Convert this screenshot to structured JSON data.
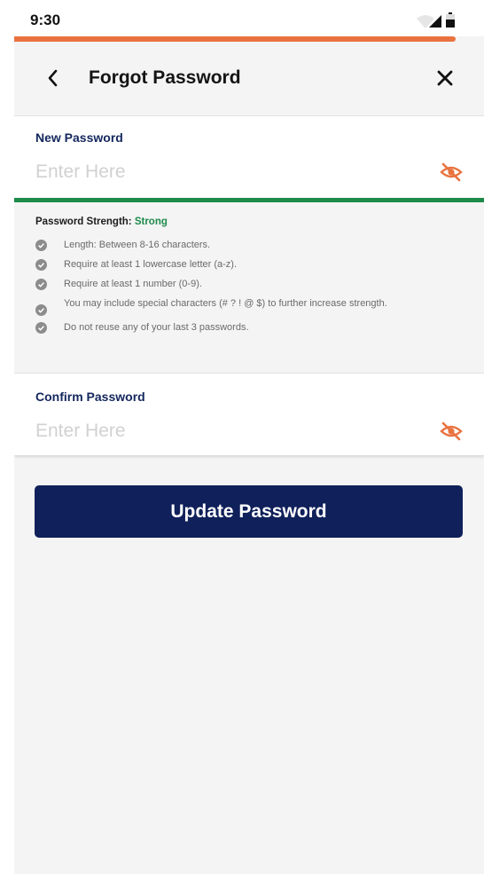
{
  "status_bar": {
    "time": "9:30",
    "icons": [
      "wifi-icon",
      "cellular-signal-icon",
      "battery-icon"
    ]
  },
  "progress": {
    "fraction": 0.94
  },
  "header": {
    "title": "Forgot Password",
    "back_icon": "chevron-left-icon",
    "close_icon": "close-icon"
  },
  "new_password": {
    "label": "New Password",
    "value": "",
    "placeholder": "Enter Here",
    "visibility_icon": "eye-off-icon"
  },
  "strength": {
    "label": "Password Strength: ",
    "value": "Strong",
    "level": 1.0,
    "rules": [
      "Length: Between 8-16 characters.",
      "Require at least 1 lowercase letter (a-z).",
      "Require at least 1 number (0-9).",
      "You may include special characters (# ? ! @ $) to further increase strength.",
      "Do not reuse any of your last 3 passwords."
    ]
  },
  "confirm_password": {
    "label": "Confirm Password",
    "value": "",
    "placeholder": "Enter Here",
    "visibility_icon": "eye-off-icon"
  },
  "submit": {
    "label": "Update Password"
  },
  "colors": {
    "accent_orange": "#e9733f",
    "strength_green": "#1d8a4a",
    "primary_navy": "#0f205a",
    "label_navy": "#14275e",
    "background": "#f4f4f4"
  }
}
